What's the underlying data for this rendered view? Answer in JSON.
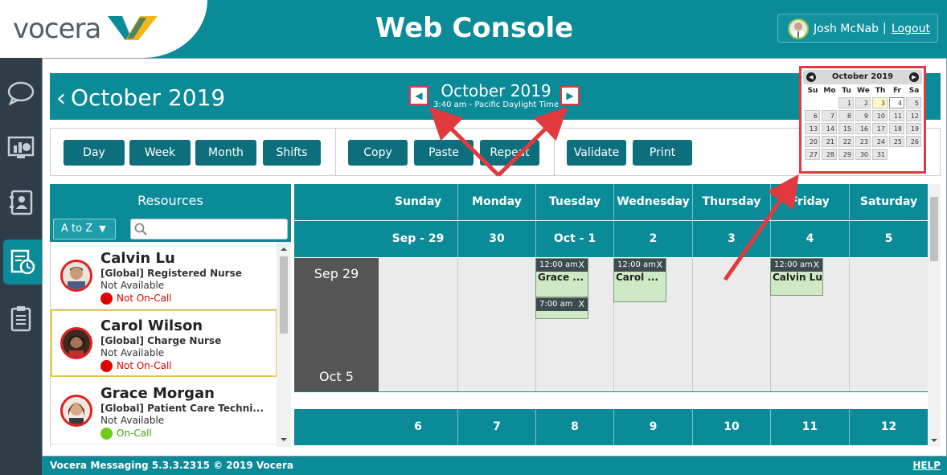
{
  "header": {
    "logo_text": "vocera",
    "title": "Web Console",
    "user_name": "Josh McNab",
    "separator": "|",
    "logout_label": "Logout"
  },
  "rail": {
    "items": [
      "messages-icon",
      "dashboard-icon",
      "contacts-icon",
      "schedule-icon",
      "clipboard-icon"
    ],
    "active": "schedule-icon"
  },
  "banner": {
    "back_chevron": "‹",
    "month_title": "October 2019",
    "center_month": "October 2019",
    "center_time": "3:40 am - Pacific Daylight Time",
    "prev_arrow": "◀",
    "next_arrow": "▶"
  },
  "toolbar": {
    "day": "Day",
    "week": "Week",
    "month": "Month",
    "shifts": "Shifts",
    "copy": "Copy",
    "paste": "Paste",
    "repeat": "Repeat",
    "validate": "Validate",
    "print": "Print"
  },
  "resources": {
    "title": "Resources",
    "sort_label": "A to Z",
    "sort_caret": "▼",
    "search_placeholder": "",
    "items": [
      {
        "name": "Calvin Lu",
        "role": "[Global] Registered Nurse",
        "availability": "Not Available",
        "status": "Not On-Call",
        "status_color": "#e00000"
      },
      {
        "name": "Carol Wilson",
        "role": "[Global] Charge Nurse",
        "availability": "Not Available",
        "status": "Not On-Call",
        "status_color": "#e00000"
      },
      {
        "name": "Grace Morgan",
        "role": "[Global] Patient Care Techni...",
        "availability": "Not Available",
        "status": "On-Call",
        "status_color": "#3aa800"
      }
    ]
  },
  "calendar": {
    "days": [
      "Sunday",
      "Monday",
      "Tuesday",
      "Wednesday",
      "Thursday",
      "Friday",
      "Saturday"
    ],
    "week1_dates": [
      "Sep - 29",
      "30",
      "Oct - 1",
      "2",
      "3",
      "4",
      "5"
    ],
    "week1_label_top": "Sep 29",
    "week1_label_bottom": "Oct 5",
    "week2_dates": [
      "6",
      "7",
      "8",
      "9",
      "10",
      "11",
      "12"
    ],
    "shifts": [
      {
        "day": "Tuesday",
        "time": "12:00 am",
        "name": "Grace ...",
        "close": "X"
      },
      {
        "day": "Tuesday",
        "time": "7:00 am",
        "name": "",
        "close": "X"
      },
      {
        "day": "Wednesday",
        "time": "12:00 am",
        "name": "Carol ...",
        "close": "X"
      },
      {
        "day": "Friday",
        "time": "12:00 am",
        "name": "Calvin Lu",
        "close": "X"
      }
    ]
  },
  "mini_calendar": {
    "title": "October 2019",
    "prev": "◀",
    "next": "▶",
    "dow": [
      "Su",
      "Mo",
      "Tu",
      "We",
      "Th",
      "Fr",
      "Sa"
    ],
    "rows": [
      [
        "",
        "",
        "1",
        "2",
        "3",
        "4",
        "5"
      ],
      [
        "6",
        "7",
        "8",
        "9",
        "10",
        "11",
        "12"
      ],
      [
        "13",
        "14",
        "15",
        "16",
        "17",
        "18",
        "19"
      ],
      [
        "20",
        "21",
        "22",
        "23",
        "24",
        "25",
        "26"
      ],
      [
        "27",
        "28",
        "29",
        "30",
        "31",
        "",
        ""
      ]
    ],
    "today": "3",
    "selected": "4"
  },
  "footer": {
    "text": "Vocera Messaging 5.3.3.2315 © 2019 Vocera",
    "help": "HELP"
  },
  "colors": {
    "teal": "#0b8a98",
    "dark_teal": "#0d6f7c",
    "rail": "#2e3d47",
    "highlight_red": "#e03a3e",
    "selected_card": "#e6c94a"
  }
}
